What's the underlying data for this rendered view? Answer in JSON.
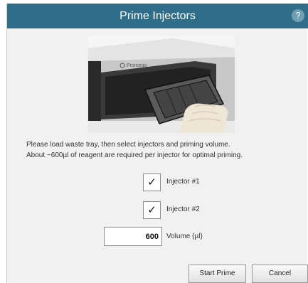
{
  "dialog": {
    "title": "Prime Injectors",
    "help_label": "?"
  },
  "photo": {
    "brand_text": "Promega"
  },
  "instructions": {
    "line1": "Please load waste tray, then select injectors and priming volume.",
    "line2": "About ~600µl of reagent are required per injector for optimal priming."
  },
  "injectors": [
    {
      "label": "Injector #1",
      "checked": true,
      "mark": "✓"
    },
    {
      "label": "Injector #2",
      "checked": true,
      "mark": "✓"
    }
  ],
  "volume": {
    "value": "600",
    "label": "Volume (µl)"
  },
  "buttons": {
    "start": "Start Prime",
    "cancel": "Cancel"
  }
}
